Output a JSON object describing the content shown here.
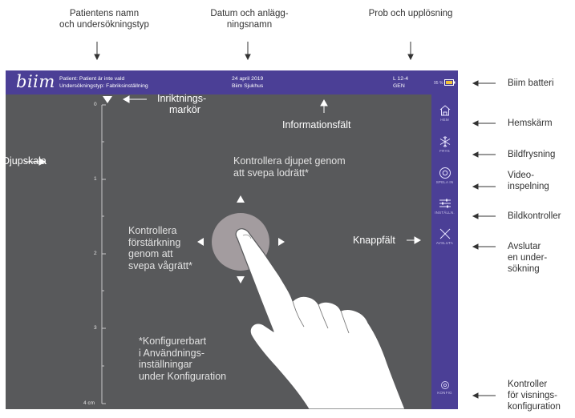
{
  "callouts": {
    "patient": [
      "Patientens namn",
      "och undersökningstyp"
    ],
    "date": [
      "Datum och anlägg-",
      "ningsnamn"
    ],
    "probe": [
      "Prob och upplösning"
    ],
    "battery": "Biim batteri",
    "home": "Hemskärm",
    "freeze": "Bildfrysning",
    "video": [
      "Video-",
      "inspelning"
    ],
    "image_controls": "Bildkontroller",
    "end": [
      "Avslutar",
      "en under-",
      "sökning"
    ],
    "display_config": [
      "Kontroller",
      "för visnings-",
      "konfiguration"
    ],
    "depth_scale": "Djupskala",
    "alignment_marker": [
      "Inriktnings-",
      "markör"
    ],
    "info_field": "Informationsfält",
    "button_field": "Knappfält"
  },
  "infobar": {
    "logo": "biim",
    "patient_line": "Patient: Patient är inte vald",
    "exam_line": "Undersökningstyp: Fabriksinställning",
    "date": "24 april 2019",
    "facility": "Biim Sjukhus",
    "probe": "L 12-4",
    "mode": "GEN",
    "battery_pct": "95 %"
  },
  "sidebar": {
    "home": "HEM",
    "freeze": "FRYS",
    "record": "SPELA IN",
    "adjust": "INSTÄLLN.",
    "end": "AVSLUTA",
    "config": "KONFIG"
  },
  "depth_scale": {
    "labels": [
      "0",
      "1",
      "2",
      "3",
      "4 cm"
    ]
  },
  "hints": {
    "depth": [
      "Kontrollera djupet genom",
      "att svepa lodrätt*"
    ],
    "gain": [
      "Kontrollera",
      "förstärkning",
      "genom att",
      "svepa vågrätt*"
    ],
    "config": [
      "*Konfigurerbart",
      "i Användnings-",
      "inställningar",
      "under Konfiguration"
    ]
  },
  "colors": {
    "bar": "#4b3f96",
    "image_bg": "#58595b",
    "touch_circle": "#a39c9f"
  }
}
